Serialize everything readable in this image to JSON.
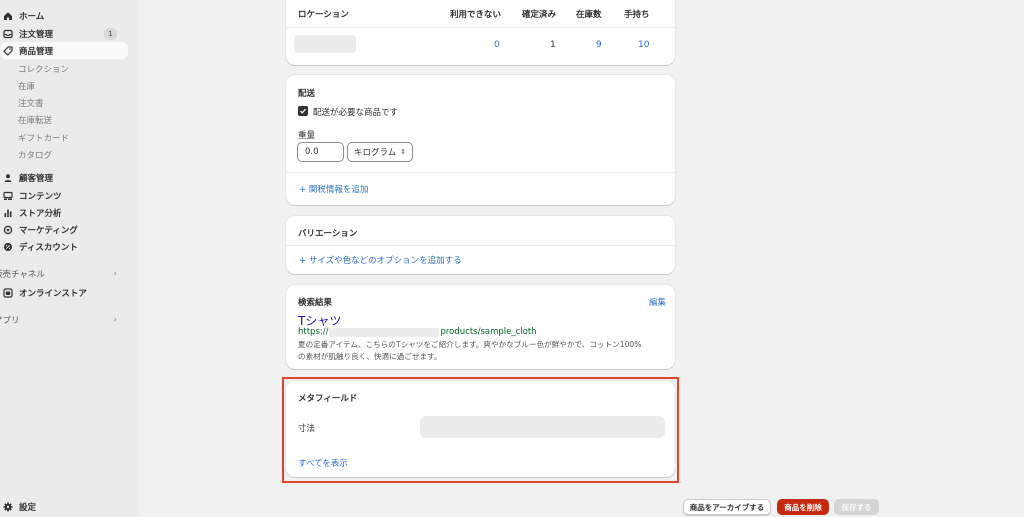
{
  "sidebar": {
    "home": "ホーム",
    "orders": "注文管理",
    "orders_badge": "1",
    "products": "商品管理",
    "product_sub": [
      "コレクション",
      "在庫",
      "注文書",
      "在庫転送",
      "ギフトカード",
      "カタログ"
    ],
    "customers": "顧客管理",
    "content": "コンテンツ",
    "analytics": "ストア分析",
    "marketing": "マーケティング",
    "discounts": "ディスカウント",
    "sales_channels": "販売チャネル",
    "online_store": "オンラインストア",
    "apps": "アプリ",
    "settings": "設定"
  },
  "inventory": {
    "col_location": "ロケーション",
    "col_unavailable": "利用できない",
    "col_committed": "確定済み",
    "col_available": "在庫数",
    "col_on_hand": "手持ち",
    "unavailable": "0",
    "committed": "1",
    "available": "9",
    "on_hand": "10"
  },
  "shipping": {
    "title": "配送",
    "physical_label": "配送が必要な商品です",
    "physical_checked": true,
    "weight_label": "重量",
    "weight_value": "0.0",
    "weight_unit": "キログラム",
    "customs_link": "+ 関税情報を追加"
  },
  "variants": {
    "title": "バリエーション",
    "add_link": "+ サイズや色などのオプションを追加する"
  },
  "seo": {
    "title": "検索結果",
    "edit": "編集",
    "page_title": "Tシャツ",
    "url_prefix": "https://",
    "url_suffix": "products/sample_cloth",
    "description_line1": "夏の定番アイテム、こちらのTシャツをご紹介します。爽やかなブルー色が鮮やかで、コットン100%",
    "description_line2": "の素材が肌触り良く、快適に過ごせます。"
  },
  "metafields": {
    "title": "メタフィールド",
    "dimension_label": "寸法",
    "show_all": "すべてを表示",
    "highlight_color": "#e0442a"
  },
  "footer": {
    "archive": "商品をアーカイブする",
    "delete": "商品を削除",
    "save": "保存する"
  }
}
